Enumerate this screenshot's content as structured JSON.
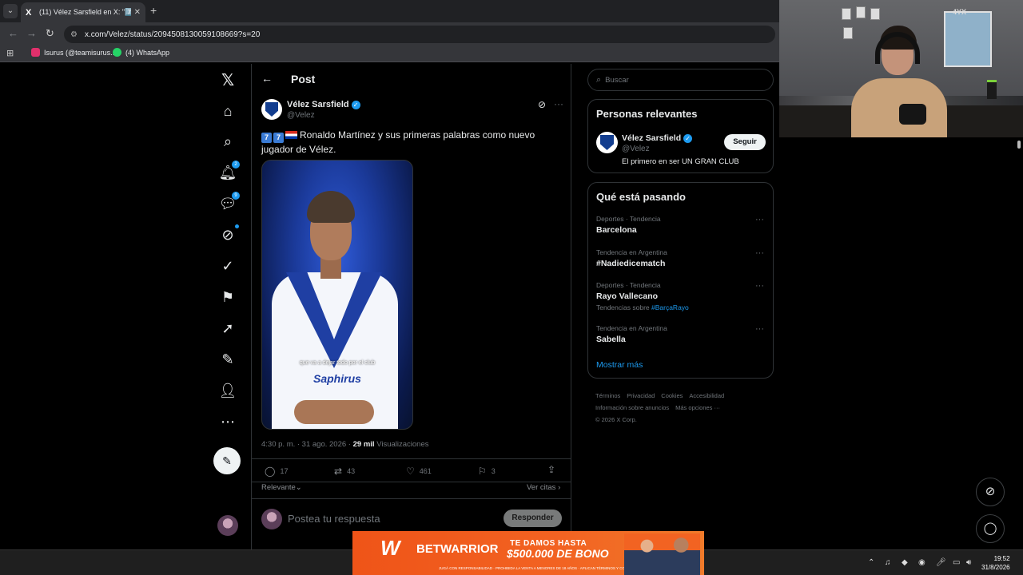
{
  "browser": {
    "tab_title": "(11) Vélez Sarsfield en X: \"7️⃣🔊",
    "tab_favicon": "X",
    "url": "x.com/Velez/status/2094508130059108669?s=20",
    "bookmarks": [
      {
        "label": "Isurus (@teamisurus...",
        "color": "#e1306c"
      },
      {
        "label": "(4) WhatsApp",
        "color": "#25d366"
      }
    ]
  },
  "nav": {
    "notif_badge": "2",
    "messages_badge": "9"
  },
  "post": {
    "header_title": "Post",
    "author_name": "Vélez Sarsfield",
    "author_handle": "@Velez",
    "keycap1": "7",
    "keycap2": "7",
    "text": "Ronaldo Martínez y sus primeras palabras como nuevo jugador de Vélez.",
    "media_caption": "que va a dejar todo por el club",
    "media_sponsor": "Saphirus",
    "time": "4:30 p. m. · 31 ago. 2026 · ",
    "views_count": "29 mil",
    "views_label": "Visualizaciones",
    "replies": "17",
    "reposts": "43",
    "likes": "461",
    "bookmarks": "3",
    "sort_label": "Relevante",
    "quotes_label": "Ver citas",
    "reply_placeholder": "Postea tu respuesta",
    "reply_button": "Responder"
  },
  "sidebar": {
    "search_placeholder": "Buscar",
    "relevant_title": "Personas relevantes",
    "relevant_name": "Vélez Sarsfield",
    "relevant_handle": "@Velez",
    "follow_label": "Seguir",
    "relevant_bio": "El primero en ser UN GRAN CLUB",
    "trends_title": "Qué está pasando",
    "trends": [
      {
        "category": "Deportes · Tendencia",
        "name": "Barcelona",
        "sub_prefix": "",
        "sub_link": ""
      },
      {
        "category": "Tendencia en Argentina",
        "name": "#Nadiedicematch",
        "sub_prefix": "",
        "sub_link": ""
      },
      {
        "category": "Deportes · Tendencia",
        "name": "Rayo Vallecano",
        "sub_prefix": "Tendencias sobre ",
        "sub_link": "#BarçaRayo"
      },
      {
        "category": "Tendencia en Argentina",
        "name": "Sabella",
        "sub_prefix": "",
        "sub_link": ""
      }
    ],
    "show_more": "Mostrar más",
    "footer": {
      "terms": "Términos",
      "privacy": "Privacidad",
      "cookies": "Cookies",
      "accessibility": "Accesibilidad",
      "ads": "Información sobre anuncios",
      "more": "Más opciones ···",
      "copyright": "© 2026 X Corp."
    }
  },
  "webcam": {
    "tag": "4YX"
  },
  "ad": {
    "brand": "BETWARRIOR",
    "promo_line1": "TE DAMOS HASTA",
    "promo_line2": "$500.000 DE BONO",
    "fine_print": "JUGÁ CON RESPONSABILIDAD · PROHIBIDA LA VENTA A MENORES DE 18 AÑOS · APLICAN TÉRMINOS Y CONDICIONES"
  },
  "taskbar": {
    "time": "19:52",
    "date": "31/8/2026"
  },
  "colors": {
    "accent": "#1d9bf0",
    "background": "#000000",
    "ad": "#f26322"
  }
}
